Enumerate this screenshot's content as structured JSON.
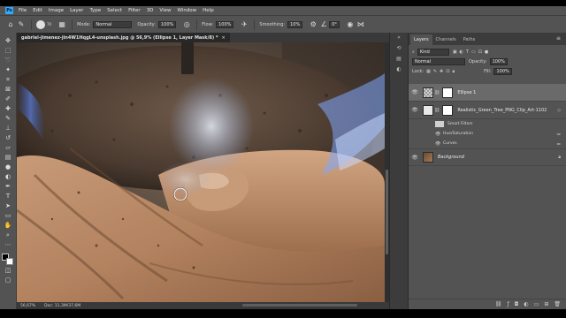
{
  "menubar": {
    "logo": "Ps",
    "items": [
      "File",
      "Edit",
      "Image",
      "Layer",
      "Type",
      "Select",
      "Filter",
      "3D",
      "View",
      "Window",
      "Help"
    ]
  },
  "options": {
    "brush_size": "70",
    "mode_label": "Mode:",
    "mode_value": "Normal",
    "opacity_label": "Opacity:",
    "opacity_value": "100%",
    "flow_label": "Flow:",
    "flow_value": "100%",
    "smoothing_label": "Smoothing:",
    "smoothing_value": "10%",
    "angle_value": "0°"
  },
  "document": {
    "tab_title": "gabriel-jimenez-jin4W1HqgL4-unsplash.jpg @ 56,9% (Ellipse 1, Layer Mask/8) *",
    "close": "×"
  },
  "status": {
    "zoom": "56,67%",
    "doc": "Doc: 11,3M/37,6M"
  },
  "panel": {
    "tabs": [
      "Layers",
      "Channels",
      "Paths"
    ],
    "active_tab": "Layers",
    "filter_kind": "Kind",
    "blend_mode": "Normal",
    "opacity_label": "Opacity:",
    "opacity_value": "100%",
    "lock_label": "Lock:",
    "fill_label": "Fill:",
    "fill_value": "100%",
    "layers": [
      {
        "name": "Ellipse 1",
        "selected": true
      },
      {
        "name": "Realistic_Green_Tree_PNG_Clip_Art-1102",
        "selected": false
      },
      {
        "name": "Background",
        "selected": false
      }
    ],
    "smart_filters": {
      "label": "Smart Filters",
      "items": [
        "Hue/Saturation",
        "Curves"
      ]
    }
  },
  "colors": {
    "accent": "#31a8ff",
    "panel_bg": "#535353",
    "app_bg": "#282828"
  }
}
